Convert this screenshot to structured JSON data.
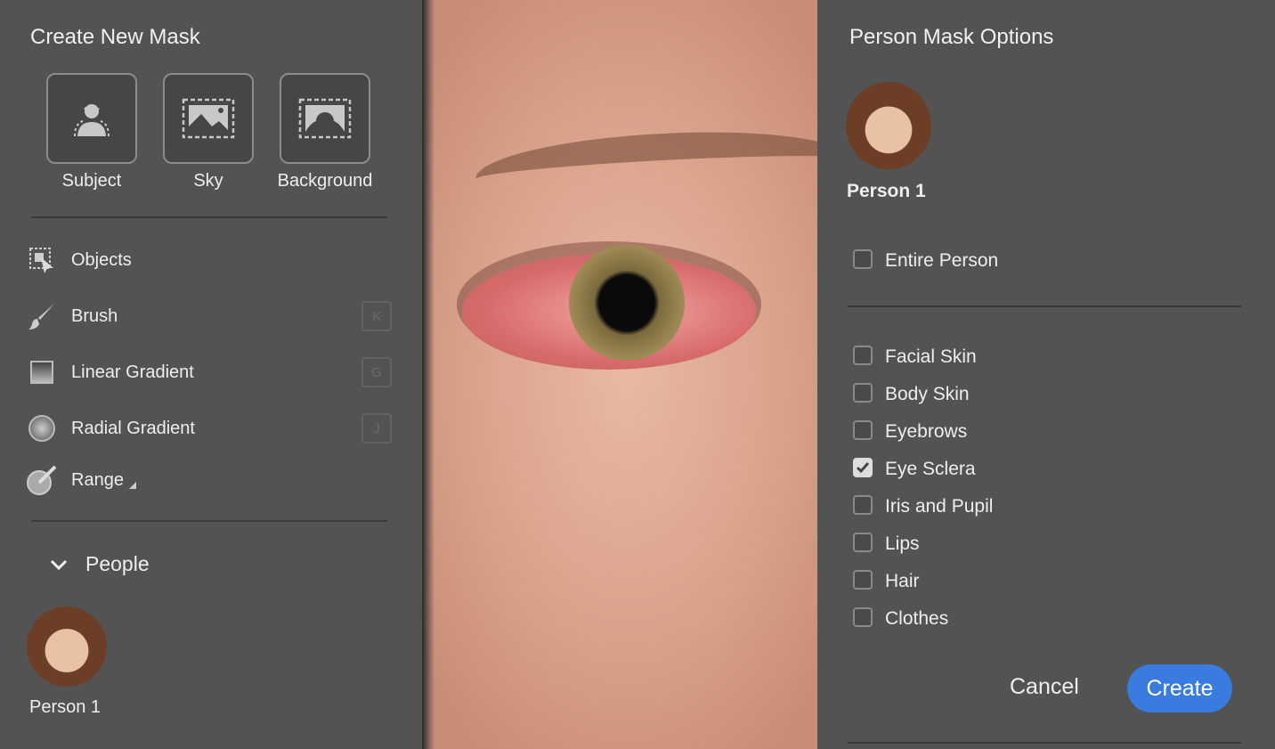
{
  "left": {
    "title": "Create New Mask",
    "tiles": [
      {
        "label": "Subject",
        "icon": "subject-icon"
      },
      {
        "label": "Sky",
        "icon": "sky-icon"
      },
      {
        "label": "Background",
        "icon": "background-icon"
      }
    ],
    "tools": [
      {
        "label": "Objects",
        "key": ""
      },
      {
        "label": "Brush",
        "key": "K"
      },
      {
        "label": "Linear Gradient",
        "key": "G"
      },
      {
        "label": "Radial Gradient",
        "key": "J"
      },
      {
        "label": "Range",
        "key": ""
      }
    ],
    "people_section": "People",
    "person": "Person 1"
  },
  "right": {
    "title": "Person Mask Options",
    "person": "Person 1",
    "entire": {
      "label": "Entire Person",
      "checked": false
    },
    "parts": [
      {
        "label": "Facial Skin",
        "checked": false
      },
      {
        "label": "Body Skin",
        "checked": false
      },
      {
        "label": "Eyebrows",
        "checked": false
      },
      {
        "label": "Eye Sclera",
        "checked": true
      },
      {
        "label": "Iris and Pupil",
        "checked": false
      },
      {
        "label": "Lips",
        "checked": false
      },
      {
        "label": "Hair",
        "checked": false
      },
      {
        "label": "Clothes",
        "checked": false
      }
    ],
    "cancel": "Cancel",
    "create": "Create"
  },
  "colors": {
    "panel": "#535353",
    "accent": "#3a7be0"
  }
}
